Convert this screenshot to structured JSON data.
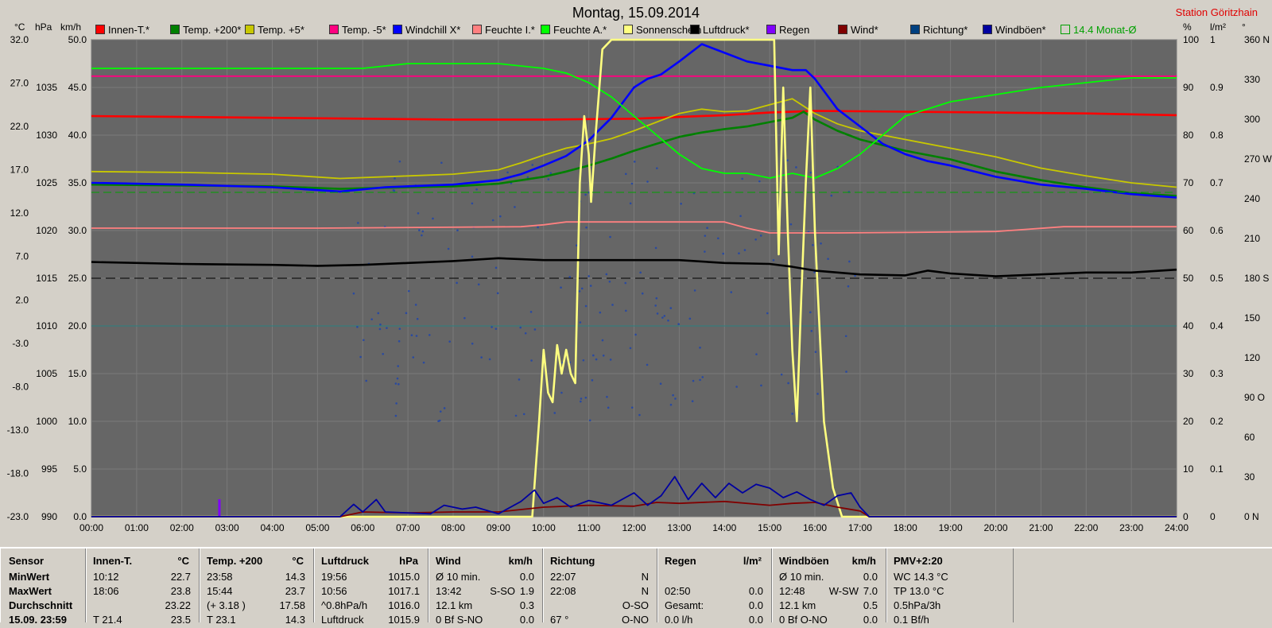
{
  "header": {
    "title": "Montag, 15.09.2014",
    "station": "Station Göritzhain",
    "units_left": [
      "°C",
      "hPa",
      "km/h"
    ],
    "units_right": [
      "%",
      "l/m²",
      "°"
    ]
  },
  "legend": [
    {
      "label": "Innen-T.*",
      "color": "#ff0000"
    },
    {
      "label": "Temp. +200*",
      "color": "#008000"
    },
    {
      "label": "Temp. +5*",
      "color": "#c8c800"
    },
    {
      "label": "Temp. -5*",
      "color": "#ff0080"
    },
    {
      "label": "Windchill X*",
      "color": "#0000ff"
    },
    {
      "label": "Feuchte I.*",
      "color": "#ff8080"
    },
    {
      "label": "Feuchte A.*",
      "color": "#00ff00"
    },
    {
      "label": "Sonnenschein",
      "color": "#ffff80"
    },
    {
      "label": "Luftdruck*",
      "color": "#000000"
    },
    {
      "label": "Regen",
      "color": "#8000ff"
    },
    {
      "label": "Wind*",
      "color": "#800000"
    },
    {
      "label": "Richtung*",
      "color": "#004080"
    },
    {
      "label": "Windböen*",
      "color": "#0000a0"
    },
    {
      "label": "14.4 Monat-Ø",
      "color": "#00a000"
    }
  ],
  "chart_data": {
    "type": "line",
    "title": "Montag, 15.09.2014",
    "x_ticks": [
      "00:00",
      "01:00",
      "02:00",
      "03:00",
      "04:00",
      "05:00",
      "06:00",
      "07:00",
      "08:00",
      "09:00",
      "10:00",
      "11:00",
      "12:00",
      "13:00",
      "14:00",
      "15:00",
      "16:00",
      "17:00",
      "18:00",
      "19:00",
      "20:00",
      "21:00",
      "22:00",
      "23:00",
      "24:00"
    ],
    "xlim": [
      0,
      24
    ],
    "axes": {
      "temp_c": [
        "32.0",
        "27.0",
        "22.0",
        "17.0",
        "12.0",
        "7.0",
        "2.0",
        "-3.0",
        "-8.0",
        "-13.0",
        "-18.0",
        "-23.0"
      ],
      "pressure_hpa": [
        "1035",
        "1030",
        "1025",
        "1020",
        "1015",
        "1010",
        "1005",
        "1000",
        "995",
        "990"
      ],
      "speed_kmh": [
        "50.0",
        "45.0",
        "40.0",
        "35.0",
        "30.0",
        "25.0",
        "20.0",
        "15.0",
        "10.0",
        "5.0",
        "0.0"
      ],
      "humidity_pct": [
        "100",
        "90",
        "80",
        "70",
        "60",
        "50",
        "40",
        "30",
        "20",
        "10",
        "0"
      ],
      "rain_lm2": [
        "1",
        "0.9",
        "0.8",
        "0.7",
        "0.6",
        "0.5",
        "0.4",
        "0.3",
        "0.2",
        "0.1",
        "0"
      ],
      "direction_deg": [
        "360 N",
        "330",
        "300",
        "270 W",
        "240",
        "210",
        "180 S",
        "150",
        "120",
        "90 O",
        "60",
        "30",
        "0 N"
      ]
    },
    "ref_lines": {
      "temp_plus5_value": 32.0,
      "month_avg_c": 14.4
    },
    "series": [
      {
        "name": "Innen-T.*",
        "unit": "°C",
        "x": [
          0,
          2,
          4,
          6,
          8,
          10,
          12,
          14,
          15,
          16,
          18,
          20,
          22,
          24
        ],
        "y": [
          23.2,
          23.1,
          23.0,
          22.9,
          22.8,
          22.8,
          22.9,
          23.3,
          23.6,
          23.8,
          23.7,
          23.6,
          23.5,
          23.3
        ]
      },
      {
        "name": "Temp. +200*",
        "unit": "°C",
        "x": [
          0,
          2,
          4,
          5.5,
          7,
          8,
          9,
          9.5,
          10,
          10.5,
          11,
          11.5,
          12,
          12.5,
          13,
          13.5,
          14,
          14.5,
          15,
          15.5,
          15.75,
          16,
          16.5,
          17,
          18,
          19,
          20,
          21,
          22,
          23,
          24
        ],
        "y": [
          15.3,
          15.2,
          15.1,
          14.8,
          15.0,
          15.1,
          15.4,
          15.8,
          16.2,
          16.8,
          17.5,
          18.3,
          19.2,
          20.0,
          20.8,
          21.3,
          21.7,
          22.0,
          22.5,
          23.0,
          23.7,
          22.8,
          21.5,
          20.5,
          19.2,
          18.2,
          16.8,
          15.8,
          15.0,
          14.3,
          14.0
        ]
      },
      {
        "name": "Temp. +5*",
        "unit": "°C",
        "x": [
          0,
          2,
          4,
          5.5,
          7,
          8,
          9,
          9.5,
          10,
          10.5,
          11,
          11.5,
          12,
          12.5,
          13,
          13.5,
          14,
          14.5,
          15,
          15.5,
          16,
          16.5,
          17,
          18,
          19,
          20,
          21,
          22,
          23,
          24
        ],
        "y": [
          16.8,
          16.7,
          16.5,
          16.0,
          16.3,
          16.5,
          17.0,
          17.8,
          18.7,
          19.5,
          20.0,
          20.6,
          21.5,
          22.5,
          23.5,
          24.0,
          23.7,
          23.8,
          24.5,
          25.2,
          23.5,
          22.3,
          21.5,
          20.5,
          19.5,
          18.5,
          17.2,
          16.3,
          15.5,
          15.0
        ]
      },
      {
        "name": "Temp. -5*",
        "unit": "°C",
        "x": [
          0,
          24
        ],
        "y": [
          27.8,
          27.8
        ]
      },
      {
        "name": "Windchill X*",
        "unit": "°C",
        "x": [
          0,
          2,
          4,
          5.5,
          6.5,
          8,
          9,
          9.5,
          10,
          10.5,
          11,
          11.5,
          12,
          12.3,
          12.6,
          13,
          13.5,
          14,
          14.5,
          15,
          15.5,
          15.8,
          16,
          16.5,
          17,
          17.5,
          18,
          18.5,
          19,
          20,
          21,
          22,
          23,
          24
        ],
        "y": [
          15.5,
          15.3,
          15.0,
          14.5,
          15.0,
          15.3,
          15.8,
          16.5,
          17.5,
          18.6,
          20.4,
          23.0,
          26.5,
          27.5,
          28.0,
          29.5,
          31.5,
          30.5,
          29.5,
          29.0,
          28.5,
          28.5,
          27.5,
          24.0,
          22.0,
          20.0,
          18.8,
          18.0,
          17.5,
          16.2,
          15.3,
          14.8,
          14.2,
          13.8
        ]
      },
      {
        "name": "Feuchte I.*",
        "unit": "%",
        "x": [
          0,
          5,
          9.5,
          10,
          10.5,
          14,
          14.5,
          15,
          16,
          16.5,
          18,
          20,
          21.5,
          24
        ],
        "y": [
          60.5,
          60.5,
          60.8,
          61.2,
          61.8,
          61.8,
          60.5,
          59.5,
          59.5,
          59.5,
          59.6,
          59.8,
          60.8,
          60.8
        ]
      },
      {
        "name": "Feuchte A.*",
        "unit": "%",
        "x": [
          0,
          6,
          7,
          8,
          9,
          10,
          10.5,
          11,
          11.5,
          12,
          12.5,
          13,
          13.5,
          14,
          14.5,
          15,
          15.5,
          16,
          16.5,
          17,
          17.5,
          18,
          19,
          20,
          21,
          22,
          23,
          24
        ],
        "y": [
          94,
          94,
          95,
          95,
          95,
          94,
          93,
          91,
          88,
          84,
          80,
          76,
          73,
          72,
          72,
          71,
          72,
          71,
          73,
          76,
          80,
          84,
          87,
          88.5,
          90,
          91,
          92,
          92
        ]
      },
      {
        "name": "Sonnenschein",
        "unit": "km/h",
        "x": [
          0,
          9.75,
          9.9,
          10,
          10.1,
          10.2,
          10.3,
          10.4,
          10.5,
          10.6,
          10.7,
          10.8,
          10.9,
          11.0,
          11.05,
          11.15,
          11.3,
          11.5,
          15.1,
          15.2,
          15.3,
          15.4,
          15.5,
          15.6,
          15.7,
          15.8,
          15.9,
          16.0,
          16.2,
          16.4,
          16.6,
          16.7,
          16.8,
          24
        ],
        "y": [
          0,
          0,
          10,
          17.5,
          13,
          12,
          18,
          15,
          17.5,
          15,
          14,
          35,
          42,
          38,
          33,
          40,
          49,
          50,
          50,
          27.5,
          45,
          30,
          17.5,
          10,
          23,
          35,
          45,
          30,
          10,
          3,
          0,
          0,
          0,
          0
        ]
      },
      {
        "name": "Luftdruck*",
        "unit": "hPa",
        "x": [
          0,
          2,
          4,
          5,
          6,
          7,
          8,
          9,
          10,
          11,
          12,
          13,
          14,
          15,
          15.5,
          16,
          17,
          18,
          18.5,
          19,
          20,
          21,
          22,
          23,
          24
        ],
        "y": [
          1016.7,
          1016.5,
          1016.4,
          1016.3,
          1016.4,
          1016.6,
          1016.8,
          1017.1,
          1016.9,
          1016.9,
          1016.9,
          1016.9,
          1016.6,
          1016.5,
          1016.2,
          1015.8,
          1015.4,
          1015.3,
          1015.8,
          1015.5,
          1015.2,
          1015.4,
          1015.6,
          1015.6,
          1015.9
        ]
      },
      {
        "name": "Regen",
        "unit": "l/m²",
        "x": [
          2.83
        ],
        "y": [
          0.02
        ]
      },
      {
        "name": "Wind*",
        "unit": "km/h",
        "x": [
          0,
          5.5,
          6,
          7,
          8,
          9,
          10,
          11,
          12,
          12.5,
          13,
          14,
          15,
          15.5,
          16,
          16.5,
          17,
          17.2,
          24
        ],
        "y": [
          0,
          0,
          0.5,
          0.4,
          0.5,
          0.5,
          1.0,
          1.2,
          1.1,
          1.5,
          1.4,
          1.6,
          1.2,
          1.4,
          1.5,
          1.0,
          0.6,
          0,
          0
        ]
      },
      {
        "name": "Windböen*",
        "unit": "km/h",
        "x": [
          0,
          5.5,
          5.8,
          6,
          6.3,
          6.5,
          7.5,
          7.8,
          8.2,
          8.5,
          9,
          9.5,
          9.8,
          10,
          10.3,
          10.6,
          11,
          11.5,
          12,
          12.3,
          12.6,
          12.9,
          13.2,
          13.5,
          13.8,
          14.1,
          14.4,
          14.7,
          15,
          15.3,
          15.6,
          15.9,
          16.2,
          16.5,
          16.8,
          17,
          17.2,
          24
        ],
        "y": [
          0,
          0,
          1.3,
          0.5,
          1.8,
          0.5,
          0.3,
          1.2,
          0.8,
          1.0,
          0.3,
          1.6,
          2.8,
          1.4,
          2.0,
          1.0,
          1.7,
          1.2,
          2.5,
          1.2,
          2.2,
          4.2,
          1.8,
          3.5,
          2.0,
          3.5,
          2.5,
          3.4,
          3.0,
          2.0,
          2.6,
          1.8,
          1.2,
          2.2,
          2.5,
          1.0,
          0,
          0
        ]
      },
      {
        "name": "14.4 Monat-Ø",
        "unit": "°C",
        "x": [
          0,
          24
        ],
        "y": [
          14.4,
          14.4
        ]
      }
    ]
  },
  "table": {
    "row_labels": [
      "Sensor",
      "MinWert",
      "MaxWert",
      "Durchschnitt",
      "15.09. 23:59"
    ],
    "columns": [
      {
        "title": "Innen-T.",
        "unit": "°C",
        "rows": [
          [
            "10:12",
            "",
            "22.7"
          ],
          [
            "18:06",
            "",
            "23.8"
          ],
          [
            "",
            "",
            "23.22"
          ],
          [
            "T  21.4",
            "",
            "23.5"
          ]
        ]
      },
      {
        "title": "Temp. +200",
        "unit": "°C",
        "rows": [
          [
            "23:58",
            "",
            "14.3"
          ],
          [
            "15:44",
            "",
            "23.7"
          ],
          [
            "(+ 3.18 )",
            "",
            "17.58"
          ],
          [
            "T  23.1",
            "",
            "14.3"
          ]
        ]
      },
      {
        "title": "Luftdruck",
        "unit": "hPa",
        "rows": [
          [
            "19:56",
            "",
            "1015.0"
          ],
          [
            "10:56",
            "",
            "1017.1"
          ],
          [
            "^0.8hPa/h",
            "",
            "1016.0"
          ],
          [
            "Luftdruck",
            "",
            "1015.9"
          ]
        ]
      },
      {
        "title": "Wind",
        "unit": "km/h",
        "rows": [
          [
            "Ø 10 min.",
            "",
            "0.0"
          ],
          [
            "13:42",
            "S-SO",
            "1.9"
          ],
          [
            "12.1 km",
            "",
            "0.3"
          ],
          [
            "0 Bf  S-NO",
            "",
            "0.0"
          ]
        ]
      },
      {
        "title": "Richtung",
        "unit": "",
        "rows": [
          [
            "22:07",
            "",
            "N"
          ],
          [
            "22:08",
            "",
            "N"
          ],
          [
            "",
            "",
            "O-SO"
          ],
          [
            "67 °",
            "",
            "O-NO"
          ]
        ]
      },
      {
        "title": "Regen",
        "unit": "l/m²",
        "rows": [
          [
            "",
            "",
            ""
          ],
          [
            "02:50",
            "",
            "0.0"
          ],
          [
            "Gesamt:",
            "",
            "0.0"
          ],
          [
            "0.0 l/h",
            "",
            "0.0"
          ]
        ]
      },
      {
        "title": "Windböen",
        "unit": "km/h",
        "rows": [
          [
            "Ø 10 min.",
            "",
            "0.0"
          ],
          [
            "12:48",
            "W-SW",
            "7.0"
          ],
          [
            "12.1 km",
            "",
            "0.5"
          ],
          [
            "0 Bf  O-NO",
            "",
            "0.0"
          ]
        ]
      },
      {
        "title": "PMV+2:20",
        "unit": "",
        "rows": [
          [
            "WC 14.3 °C",
            "",
            ""
          ],
          [
            "TP 13.0 °C",
            "",
            ""
          ],
          [
            "0.5hPa/3h",
            "",
            ""
          ],
          [
            "0.1 Bf/h",
            "",
            ""
          ]
        ]
      }
    ]
  }
}
